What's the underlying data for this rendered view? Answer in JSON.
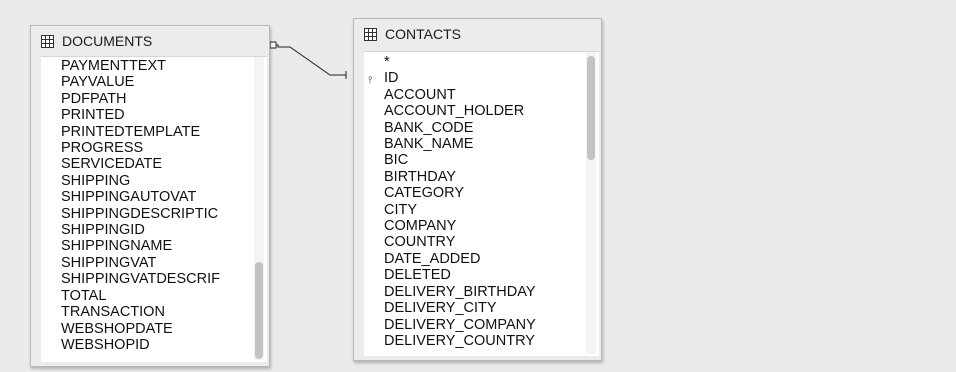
{
  "documents_table": {
    "title": "DOCUMENTS",
    "fields": [
      "PAYMENTTEXT",
      "PAYVALUE",
      "PDFPATH",
      "PRINTED",
      "PRINTEDTEMPLATE",
      "PROGRESS",
      "SERVICEDATE",
      "SHIPPING",
      "SHIPPINGAUTOVAT",
      "SHIPPINGDESCRIPTIC",
      "SHIPPINGID",
      "SHIPPINGNAME",
      "SHIPPINGVAT",
      "SHIPPINGVATDESCRIF",
      "TOTAL",
      "TRANSACTION",
      "WEBSHOPDATE",
      "WEBSHOPID"
    ],
    "scroll_position": 0.85
  },
  "contacts_table": {
    "title": "CONTACTS",
    "fields": [
      "*",
      "ID",
      "ACCOUNT",
      "ACCOUNT_HOLDER",
      "BANK_CODE",
      "BANK_NAME",
      "BIC",
      "BIRTHDAY",
      "CATEGORY",
      "CITY",
      "COMPANY",
      "COUNTRY",
      "DATE_ADDED",
      "DELETED",
      "DELIVERY_BIRTHDAY",
      "DELIVERY_CITY",
      "DELIVERY_COMPANY",
      "DELIVERY_COUNTRY"
    ],
    "primary_key_field": "ID",
    "scroll_position": 0.0
  },
  "icons": {
    "table_icon": "table-grid-icon",
    "key_icon": "primary-key-icon"
  }
}
